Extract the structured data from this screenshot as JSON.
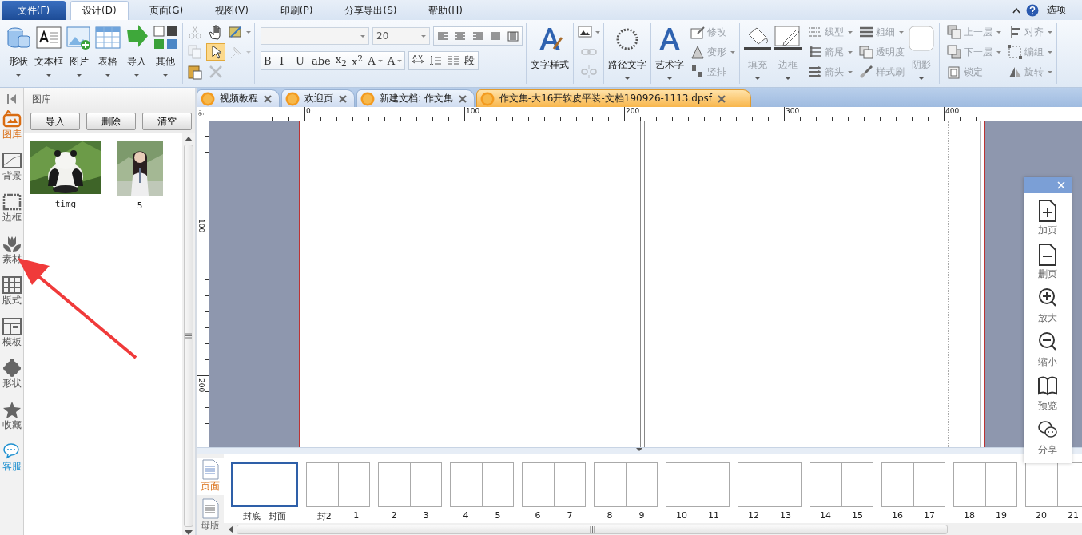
{
  "menu": {
    "tabs": [
      {
        "label": "文件(F)",
        "kind": "file",
        "selected": false
      },
      {
        "label": "设计(D)",
        "kind": "tab",
        "selected": true
      },
      {
        "label": "页面(G)",
        "kind": "tab",
        "selected": false
      },
      {
        "label": "视图(V)",
        "kind": "tab",
        "selected": false
      },
      {
        "label": "印刷(P)",
        "kind": "tab",
        "selected": false
      },
      {
        "label": "分享导出(S)",
        "kind": "tab",
        "selected": false
      },
      {
        "label": "帮助(H)",
        "kind": "tab",
        "selected": false
      }
    ],
    "options_label": "选项"
  },
  "ribbon": {
    "groups": [
      [
        {
          "kind": "large",
          "label": "形状",
          "dropdown": true,
          "disabled": false
        },
        {
          "kind": "large",
          "label": "文本框",
          "dropdown": true,
          "disabled": false
        },
        {
          "kind": "large",
          "label": "图片",
          "dropdown": true,
          "disabled": false
        },
        {
          "kind": "large",
          "label": "表格",
          "dropdown": true,
          "disabled": false
        },
        {
          "kind": "large",
          "label": "导入",
          "dropdown": true,
          "disabled": false
        },
        {
          "kind": "large",
          "label": "其他",
          "dropdown": true,
          "disabled": false
        }
      ],
      [
        {
          "kind": "tools",
          "items": [
            {
              "selected": false,
              "disabled": true,
              "dropdown": false
            },
            {
              "selected": false,
              "disabled": false,
              "dropdown": false
            },
            {
              "selected": false,
              "disabled": false,
              "dropdown": true
            },
            {
              "selected": false,
              "disabled": true,
              "dropdown": false
            },
            {
              "selected": true,
              "disabled": false,
              "dropdown": false
            },
            {
              "selected": false,
              "disabled": true,
              "dropdown": true
            },
            {
              "selected": false,
              "disabled": false,
              "dropdown": false
            },
            {
              "selected": false,
              "disabled": true,
              "dropdown": false
            }
          ]
        }
      ],
      [
        {
          "kind": "font",
          "size": "20",
          "format_buttons": [
            {
              "label": "B",
              "dropdown": false
            },
            {
              "label": "I",
              "dropdown": false
            },
            {
              "label": "U",
              "dropdown": false
            },
            {
              "label": "abe",
              "dropdown": false
            },
            {
              "label": "x$_{2}$",
              "dropdown": false
            },
            {
              "label": "x$^{2}$",
              "dropdown": false
            },
            {
              "label": "A",
              "dropdown": true
            },
            {
              "label": "A",
              "dropdown": true
            }
          ],
          "paragraph_label": "段"
        }
      ],
      [
        {
          "kind": "large",
          "label": "文字样式",
          "dropdown": false,
          "disabled": false
        }
      ],
      [
        {
          "kind": "tools",
          "items": [
            {
              "selected": false,
              "disabled": false,
              "dropdown": true
            },
            {
              "selected": false,
              "disabled": true,
              "dropdown": false
            },
            {
              "selected": false,
              "disabled": true,
              "dropdown": false
            }
          ]
        }
      ],
      [
        {
          "kind": "large",
          "label": "路径文字",
          "dropdown": true,
          "disabled": false
        }
      ],
      [
        {
          "kind": "large",
          "label": "艺术字",
          "dropdown": true,
          "disabled": false
        },
        {
          "kind": "stack",
          "items": [
            {
              "label": "修改",
              "dropdown": false,
              "disabled": true
            },
            {
              "label": "变形",
              "dropdown": true,
              "disabled": true
            },
            {
              "label": "竖排",
              "dropdown": false,
              "disabled": true
            }
          ]
        }
      ],
      [
        {
          "kind": "large",
          "label": "填充",
          "dropdown": true,
          "disabled": true
        },
        {
          "kind": "large",
          "label": "边框",
          "dropdown": true,
          "disabled": true
        },
        {
          "kind": "stack",
          "items": [
            {
              "label": "线型",
              "dropdown": true,
              "disabled": true
            },
            {
              "label": "箭尾",
              "dropdown": true,
              "disabled": true
            },
            {
              "label": "箭头",
              "dropdown": true,
              "disabled": true
            }
          ]
        },
        {
          "kind": "stack",
          "items": [
            {
              "label": "粗细",
              "dropdown": true,
              "disabled": true
            },
            {
              "label": "透明度",
              "dropdown": false,
              "disabled": true
            },
            {
              "label": "样式刷",
              "dropdown": false,
              "disabled": true
            }
          ]
        },
        {
          "kind": "large",
          "label": "阴影",
          "dropdown": true,
          "disabled": true
        }
      ],
      [
        {
          "kind": "stack",
          "items": [
            {
              "label": "上一层",
              "dropdown": true,
              "disabled": true
            },
            {
              "label": "下一层",
              "dropdown": true,
              "disabled": true
            },
            {
              "label": "锁定",
              "dropdown": false,
              "disabled": true
            }
          ]
        },
        {
          "kind": "stack",
          "items": [
            {
              "label": "对齐",
              "dropdown": true,
              "disabled": true
            },
            {
              "label": "编组",
              "dropdown": true,
              "disabled": true
            },
            {
              "label": "旋转",
              "dropdown": true,
              "disabled": true
            }
          ]
        }
      ]
    ]
  },
  "side_strip": [
    {
      "label": "图库",
      "kind": "tool",
      "selected": true
    },
    {
      "label": "背景",
      "kind": "tool",
      "selected": false
    },
    {
      "label": "边框",
      "kind": "tool",
      "selected": false
    },
    {
      "label": "素材",
      "kind": "tool",
      "selected": false
    },
    {
      "label": "版式",
      "kind": "tool",
      "selected": false
    },
    {
      "label": "模板",
      "kind": "tool",
      "selected": false
    },
    {
      "label": "形状",
      "kind": "tool",
      "selected": false
    },
    {
      "label": "收藏",
      "kind": "tool",
      "selected": false
    },
    {
      "label": "客服",
      "kind": "service",
      "selected": false
    }
  ],
  "library": {
    "title": "图库",
    "buttons": [
      "导入",
      "删除",
      "清空"
    ],
    "images": [
      {
        "caption": "timg",
        "kind": "picture"
      },
      {
        "caption": "5",
        "kind": "picture"
      }
    ]
  },
  "documents": {
    "tabs": [
      {
        "label": "视频教程",
        "selected": false
      },
      {
        "label": "欢迎页",
        "selected": false
      },
      {
        "label": "新建文档: 作文集",
        "selected": false
      },
      {
        "label": "作文集-大16开软皮平装-文档190926-1113.dpsf",
        "selected": true
      }
    ],
    "ruler_h": [
      "0",
      "100",
      "200",
      "300",
      "400"
    ],
    "ruler_v": [
      "100",
      "200"
    ]
  },
  "quick_panel": {
    "actions": [
      "加页",
      "删页",
      "放大",
      "缩小",
      "预览",
      "分享"
    ]
  },
  "pages": {
    "tabs": [
      {
        "label": "页面",
        "selected": true
      },
      {
        "label": "母版",
        "selected": false
      }
    ],
    "spreads": [
      {
        "labels": [
          "封底 - 封面"
        ],
        "selected": true
      },
      {
        "labels": [
          "封2",
          "1"
        ],
        "selected": false
      },
      {
        "labels": [
          "2",
          "3"
        ],
        "selected": false
      },
      {
        "labels": [
          "4",
          "5"
        ],
        "selected": false
      },
      {
        "labels": [
          "6",
          "7"
        ],
        "selected": false
      },
      {
        "labels": [
          "8",
          "9"
        ],
        "selected": false
      },
      {
        "labels": [
          "10",
          "11"
        ],
        "selected": false
      },
      {
        "labels": [
          "12",
          "13"
        ],
        "selected": false
      },
      {
        "labels": [
          "14",
          "15"
        ],
        "selected": false
      },
      {
        "labels": [
          "16",
          "17"
        ],
        "selected": false
      },
      {
        "labels": [
          "18",
          "19"
        ],
        "selected": false
      },
      {
        "labels": [
          "20",
          "21"
        ],
        "selected": false
      }
    ]
  }
}
